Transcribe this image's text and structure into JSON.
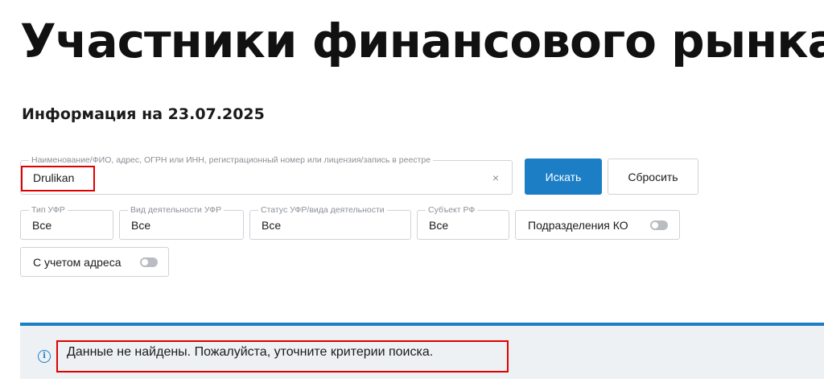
{
  "page": {
    "title": "Участники финансового рынка",
    "info_date": "Информация на 23.07.2025"
  },
  "search": {
    "label": "Наименование/ФИО, адрес, ОГРН или ИНН, регистрационный номер или лицензия/запись в реестре",
    "value": "Drulikan",
    "clear_glyph": "×",
    "search_button": "Искать",
    "reset_button": "Сбросить"
  },
  "filters": [
    {
      "label": "Тип УФР",
      "value": "Все"
    },
    {
      "label": "Вид деятельности УФР",
      "value": "Все"
    },
    {
      "label": "Статус УФР/вида деятельности",
      "value": "Все"
    },
    {
      "label": "Субъект РФ",
      "value": "Все"
    }
  ],
  "toggles": {
    "divisions_ko": {
      "label": "Подразделения КО",
      "on": false
    },
    "with_address": {
      "label": "С учетом адреса",
      "on": false
    }
  },
  "alert": {
    "icon": "info-icon",
    "message": "Данные не найдены. Пожалуйста, уточните критерии поиска."
  },
  "colors": {
    "accent": "#1c7fc6",
    "highlight": "#e00000",
    "alert_bg": "#eef1f4"
  }
}
